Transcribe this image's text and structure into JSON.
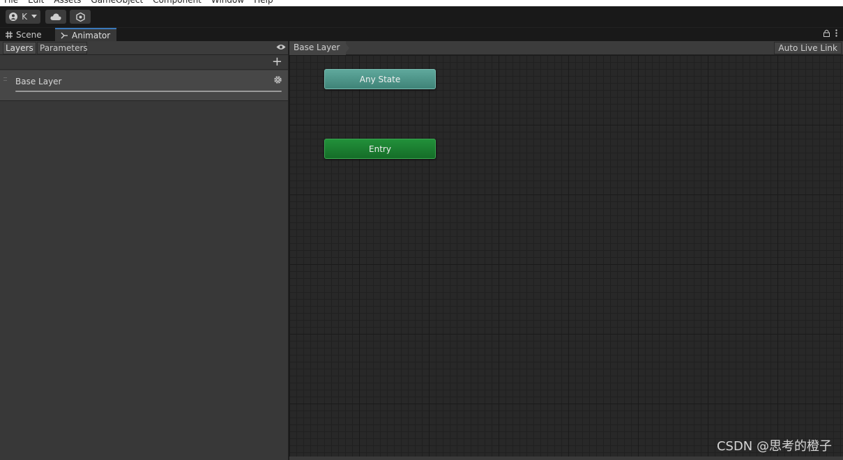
{
  "menu": [
    "File",
    "Edit",
    "Assets",
    "GameObject",
    "Component",
    "Window",
    "Help"
  ],
  "toolbar": {
    "account_label": "K",
    "account_icon": "account-icon",
    "cloud_icon": "cloud-icon",
    "collab_icon": "collab-icon"
  },
  "tabs": [
    {
      "label": "Scene",
      "icon": "grid-icon"
    },
    {
      "label": "Animator",
      "icon": "animator-icon",
      "active": true
    }
  ],
  "left_panel": {
    "tabs": [
      "Layers",
      "Parameters"
    ],
    "add_label": "+",
    "layers": [
      {
        "name": "Base Layer"
      }
    ]
  },
  "graph": {
    "breadcrumb": "Base Layer",
    "auto_live_link": "Auto Live Link",
    "nodes": [
      {
        "name": "Any State",
        "color": "#4f968a"
      },
      {
        "name": "Entry",
        "color": "#1c7e31"
      }
    ]
  },
  "watermark": "CSDN @思考的橙子"
}
